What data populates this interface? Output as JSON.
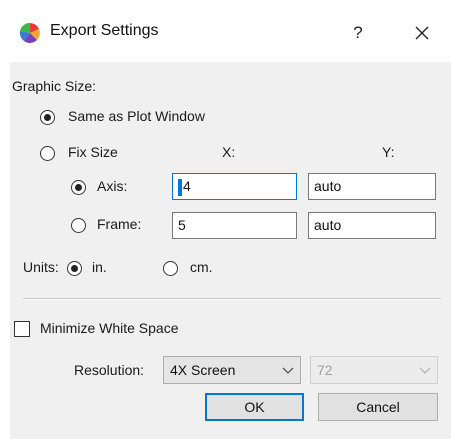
{
  "window": {
    "title": "Export Settings",
    "help_glyph": "?",
    "close_glyph": "✕",
    "icon": "plot-app-icon"
  },
  "graphic_size": {
    "heading": "Graphic Size:",
    "same_as_plot_label": "Same as Plot Window",
    "same_as_plot_selected": true,
    "fix_size_label": "Fix Size",
    "fix_size_selected": false,
    "col_x": "X:",
    "col_y": "Y:",
    "axis_label": "Axis:",
    "axis_selected": true,
    "axis_x": "4",
    "axis_y": "auto",
    "frame_label": "Frame:",
    "frame_selected": false,
    "frame_x": "5",
    "frame_y": "auto"
  },
  "units": {
    "label": "Units:",
    "in_label": "in.",
    "in_selected": true,
    "cm_label": "cm.",
    "cm_selected": false
  },
  "minimize": {
    "label": "Minimize White Space",
    "checked": false
  },
  "resolution": {
    "label": "Resolution:",
    "mode_value": "4X Screen",
    "dpi_value": "72",
    "dpi_disabled": true
  },
  "buttons": {
    "ok": "OK",
    "cancel": "Cancel"
  },
  "colors": {
    "accent": "#0078d7",
    "dialog_bg": "#f0f0f0"
  }
}
